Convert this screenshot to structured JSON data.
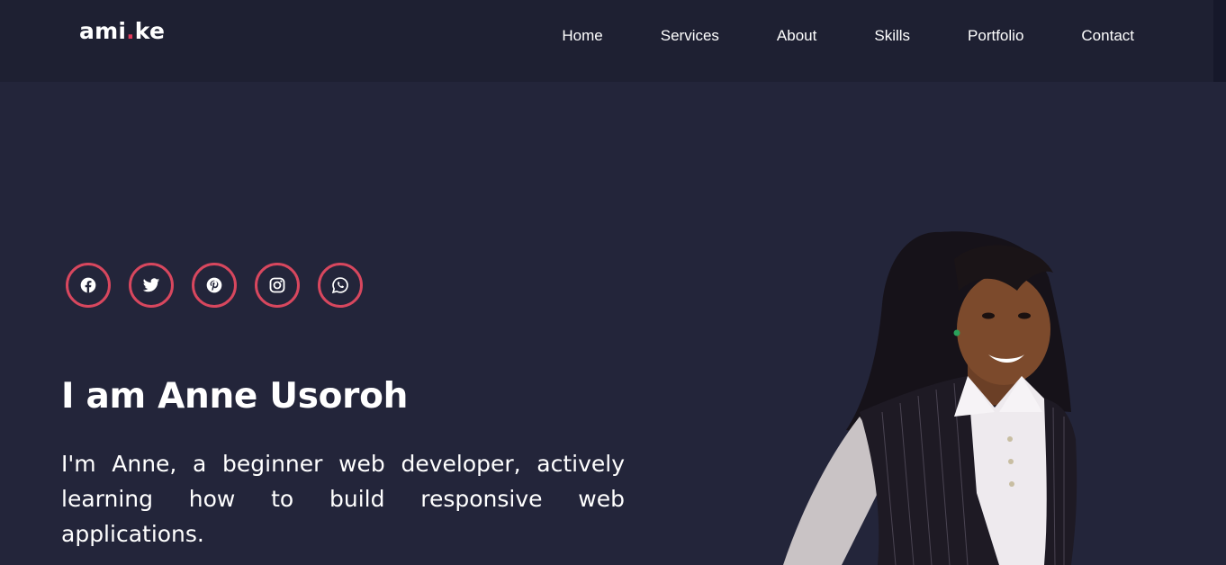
{
  "header": {
    "logo": {
      "prefix": "ami",
      "dot": ".",
      "suffix": "ke"
    },
    "nav": [
      "Home",
      "Services",
      "About",
      "Skills",
      "Portfolio",
      "Contact"
    ]
  },
  "hero": {
    "socials": [
      "facebook-icon",
      "twitter-icon",
      "pinterest-icon",
      "instagram-icon",
      "whatsapp-icon"
    ],
    "title": "I am Anne Usoroh",
    "description": "I'm Anne, a beginner web developer, actively learning how to build responsive web applications."
  },
  "colors": {
    "background": "#23253a",
    "navbar": "#1e2032",
    "accent": "#e23a5b",
    "social_border": "#d8475e"
  }
}
